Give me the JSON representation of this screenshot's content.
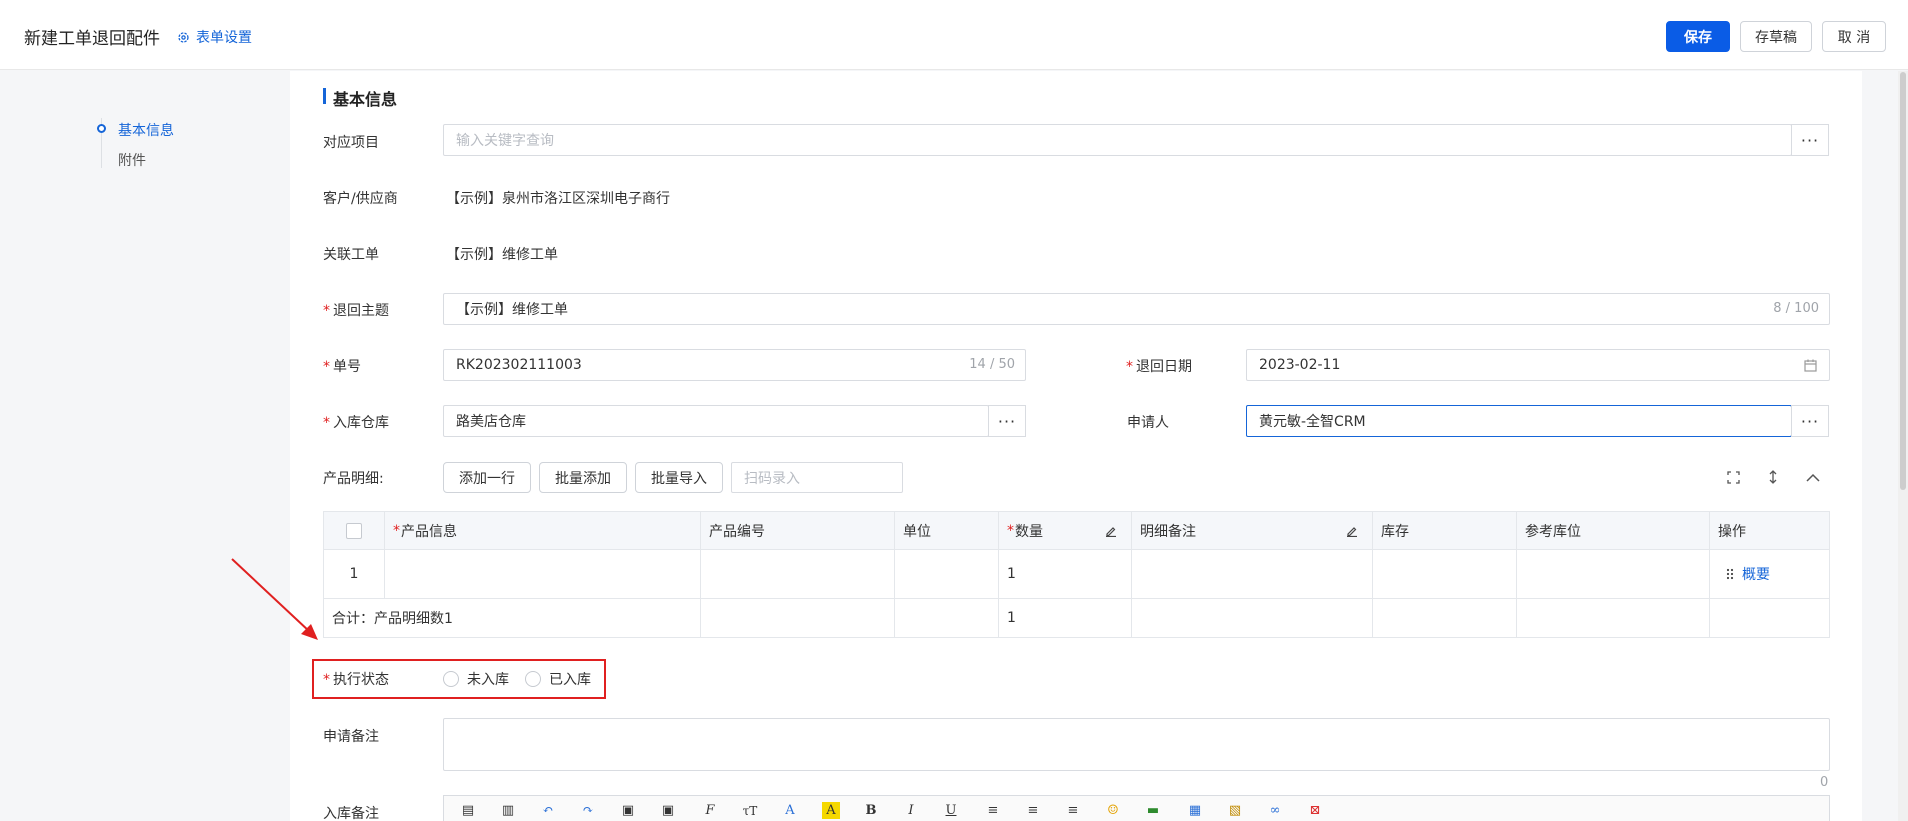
{
  "header": {
    "title": "新建工单退回配件",
    "settings_label": "表单设置",
    "save": "保存",
    "draft": "存草稿",
    "cancel": "取 消"
  },
  "nav": {
    "items": [
      {
        "label": "基本信息",
        "active": true
      },
      {
        "label": "附件",
        "active": false
      }
    ]
  },
  "section": {
    "title": "基本信息"
  },
  "form": {
    "project": {
      "label": "对应项目",
      "placeholder": "输入关键字查询"
    },
    "customer": {
      "label": "客户/供应商",
      "value": "【示例】泉州市洛江区深圳电子商行"
    },
    "related_order": {
      "label": "关联工单",
      "value": "【示例】维修工单"
    },
    "subject": {
      "label": "退回主题",
      "value": "【示例】维修工单",
      "counter": "8 / 100"
    },
    "number": {
      "label": "单号",
      "value": "RK202302111003",
      "counter": "14 / 50"
    },
    "return_date": {
      "label": "退回日期",
      "value": "2023-02-11"
    },
    "warehouse": {
      "label": "入库仓库",
      "value": "路美店仓库"
    },
    "applicant": {
      "label": "申请人",
      "value": "黄元敏-全智CRM"
    },
    "products": {
      "label": "产品明细:",
      "add_row": "添加一行",
      "batch_add": "批量添加",
      "batch_import": "批量导入",
      "scan_placeholder": "扫码录入"
    },
    "status": {
      "label": "执行状态",
      "options": [
        "未入库",
        "已入库"
      ]
    },
    "apply_note": {
      "label": "申请备注",
      "counter": "0"
    },
    "stock_note": {
      "label": "入库备注"
    }
  },
  "table": {
    "headers": [
      "产品信息",
      "产品编号",
      "单位",
      "数量",
      "明细备注",
      "库存",
      "参考库位",
      "操作"
    ],
    "row": {
      "index": "1",
      "qty": "1",
      "action": "概要"
    },
    "total": {
      "label": "合计：产品明细数1",
      "qty": "1"
    }
  },
  "colors": {
    "primary": "#0a5ce6",
    "link": "#1565d8",
    "required": "#e02020",
    "highlight": "#e02020"
  }
}
